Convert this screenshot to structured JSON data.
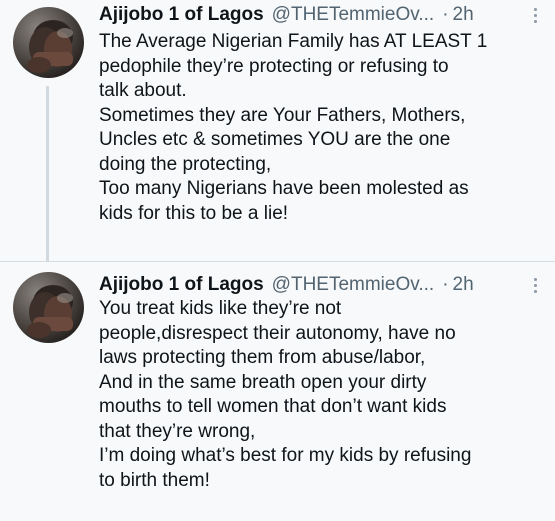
{
  "tweets": [
    {
      "display_name": "Ajijobo 1 of Lagos",
      "handle": "@THETemmieOv...",
      "separator": "·",
      "time": "2h",
      "lines": [
        "The Average Nigerian Family has AT LEAST 1",
        "pedophile they’re protecting or refusing to",
        "talk about.",
        "Sometimes they are Your Fathers, Mothers,",
        "Uncles etc & sometimes YOU are the one",
        "doing the protecting,",
        "Too many Nigerians have been molested as",
        "kids for this to be a lie!"
      ],
      "more_icon": "more-vertical-icon"
    },
    {
      "display_name": "Ajijobo 1 of Lagos",
      "handle": "@THETemmieOv...",
      "separator": "·",
      "time": "2h",
      "lines": [
        "You treat kids like they’re not",
        "people,disrespect their autonomy, have no",
        "laws protecting them from abuse/labor,",
        "And in the same breath open your dirty",
        "mouths to tell women that don’t want kids",
        "that they’re wrong,",
        "I’m doing what’s best for my kids by refusing",
        "to birth them!"
      ],
      "more_icon": "more-vertical-icon"
    }
  ],
  "colors": {
    "background": "#f7f9fa",
    "text": "#0f1419",
    "secondary_text": "#536471",
    "thread_line": "#cfd9de"
  }
}
